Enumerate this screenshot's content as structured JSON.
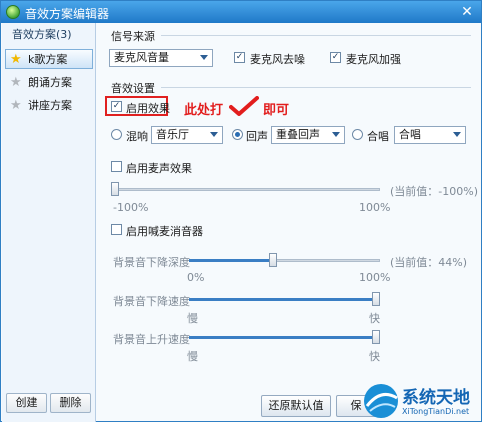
{
  "window": {
    "title": "音效方案编辑器"
  },
  "sidebar": {
    "header": "音效方案(3)",
    "items": [
      {
        "label": "k歌方案",
        "icon": "star-icon",
        "active": true
      },
      {
        "label": "朗诵方案",
        "icon": "star-icon",
        "active": false
      },
      {
        "label": "讲座方案",
        "icon": "star-icon",
        "active": false
      }
    ],
    "create_label": "创建",
    "delete_label": "删除"
  },
  "signal": {
    "title": "信号来源",
    "source_value": "麦克风音量",
    "denoise_label": "麦克风去噪",
    "denoise_checked": true,
    "boost_label": "麦克风加强",
    "boost_checked": true
  },
  "effects": {
    "title": "音效设置",
    "enable_label": "启用效果",
    "enable_checked": true,
    "annotation": "此处打",
    "annotation_tail": "即可",
    "reverb_label": "混响",
    "reverb_value": "音乐厅",
    "echo_label": "回声",
    "echo_value": "重叠回声",
    "chorus_label": "合唱",
    "chorus_value": "合唱",
    "selected_mode": "echo",
    "mic_label": "启用麦声效果",
    "mic_checked": false,
    "mic_current": "(当前值：-100%)",
    "mic_min": "-100%",
    "mic_max": "100%",
    "mic_value": -100,
    "whistle_label": "启用喊麦消音器",
    "whistle_checked": false,
    "bg_depth_label": "背景音下降深度",
    "bg_depth_current": "(当前值：44%)",
    "bg_depth_min": "0%",
    "bg_depth_max": "100%",
    "bg_depth_value": 44,
    "bg_down_label": "背景音下降速度",
    "bg_down_min": "慢",
    "bg_down_max": "快",
    "bg_down_value": 100,
    "bg_up_label": "背景音上升速度",
    "bg_up_min": "慢",
    "bg_up_max": "快",
    "bg_up_value": 100
  },
  "footer": {
    "restore_label": "还原默认值",
    "save_label": "保"
  },
  "watermark": {
    "brand": "系统天地",
    "url": "XiTongTianDi.net"
  },
  "colors": {
    "accent": "#1f79c8",
    "annotation": "#e21d1d",
    "track_fill": "#3a7ec4",
    "track_empty": "#cfd8e2"
  }
}
